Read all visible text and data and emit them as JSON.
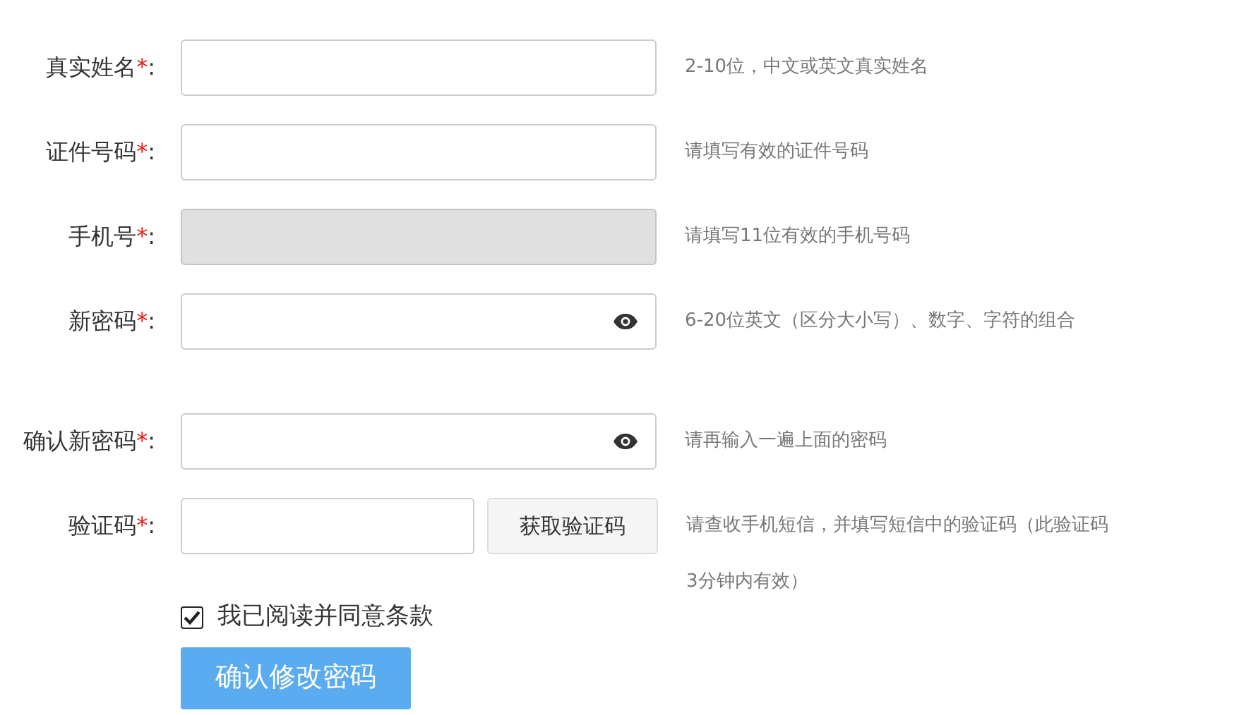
{
  "fields": [
    {
      "kind": "text",
      "label": "真实姓名",
      "star": "*",
      "colon": ":",
      "disabled": false,
      "hint": "2-10位，中文或英文真实姓名"
    },
    {
      "kind": "text",
      "label": "证件号码",
      "star": "*",
      "colon": ":",
      "disabled": false,
      "hint": "请填写有效的证件号码"
    },
    {
      "kind": "text",
      "label": "手机号",
      "star": "*",
      "colon": ":",
      "disabled": true,
      "hint": "请填写11位有效的手机号码"
    },
    {
      "kind": "password",
      "label": "新密码",
      "star": "*",
      "colon": ":",
      "disabled": false,
      "hint": "6-20位英文（区分大小写）、数字、字符的组合"
    },
    {
      "kind": "password",
      "label": "确认新密码",
      "star": "*",
      "colon": ":",
      "disabled": false,
      "hint": "请再输入一遍上面的密码"
    },
    {
      "kind": "code",
      "label": "验证码",
      "star": "*",
      "colon": ":",
      "disabled": false,
      "button": "获取验证码",
      "hint": "请查收手机短信，并填写短信中的验证码（此验证码3分钟内有效）"
    }
  ],
  "agree": {
    "label": "我已阅读并同意条款",
    "checked": true
  },
  "submit": "确认修改密码"
}
